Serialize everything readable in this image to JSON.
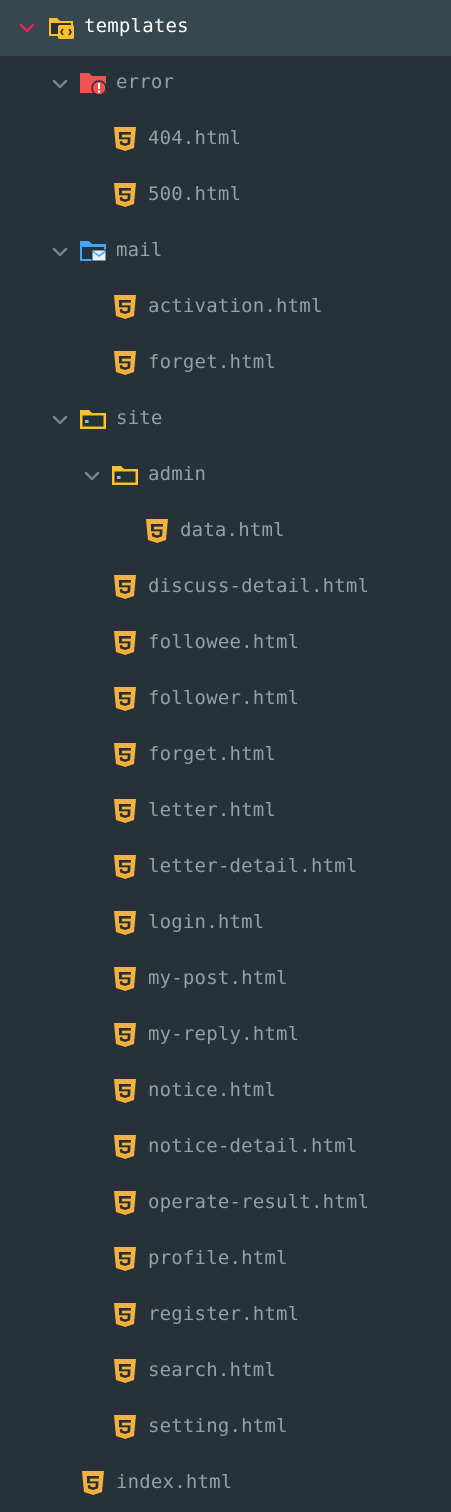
{
  "explorer": {
    "templates": {
      "label": "templates",
      "error": {
        "label": "error",
        "files": [
          "404.html",
          "500.html"
        ]
      },
      "mail": {
        "label": "mail",
        "files": [
          "activation.html",
          "forget.html"
        ]
      },
      "site": {
        "label": "site",
        "admin": {
          "label": "admin",
          "files": [
            "data.html"
          ]
        },
        "files": [
          "discuss-detail.html",
          "followee.html",
          "follower.html",
          "forget.html",
          "letter.html",
          "letter-detail.html",
          "login.html",
          "my-post.html",
          "my-reply.html",
          "notice.html",
          "notice-detail.html",
          "operate-result.html",
          "profile.html",
          "register.html",
          "search.html",
          "setting.html"
        ]
      },
      "files": [
        "index.html"
      ]
    }
  },
  "colors": {
    "background": "#263238",
    "selected_row": "#37474f",
    "text": "#8fa1ab",
    "selected_text": "#ffffff",
    "chevron": "#6f8793",
    "selected_chevron": "#e91e63",
    "html_icon": "#f5b041",
    "error_folder": "#ef5350",
    "mail_folder": "#42a5f5",
    "site_folder": "#fbc02d",
    "templates_folder": "#fbc02d"
  },
  "icons": {
    "chevron": "chevron-down-icon",
    "templates": "templates-folder-icon",
    "error": "error-folder-icon",
    "mail": "mail-folder-icon",
    "site": "folder-icon",
    "html": "html5-icon"
  }
}
